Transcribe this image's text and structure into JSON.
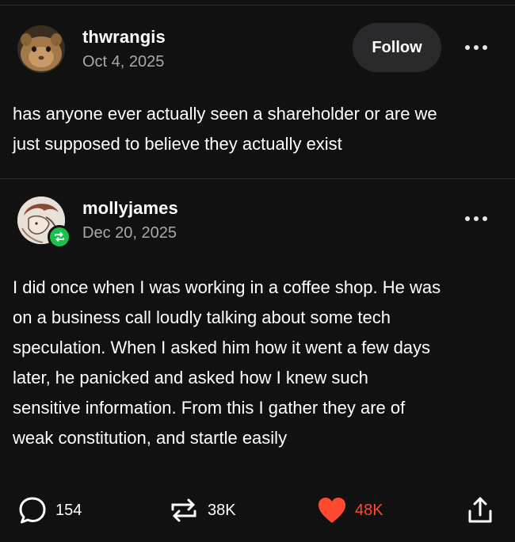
{
  "post": {
    "username": "thwrangis",
    "date": "Oct 4, 2025",
    "follow_label": "Follow",
    "text": "has anyone ever actually seen a shareholder or are we\njust supposed to believe they actually exist"
  },
  "reply": {
    "username": "mollyjames",
    "date": "Dec 20, 2025",
    "text": "I did once when I was working in a coffee shop. He was\non a business call loudly talking about some tech\nspeculation. When I asked him how it went a few days\nlater, he panicked and asked how I knew such\nsensitive information. From this I gather they are of\nweak constitution, and startle easily"
  },
  "actions": {
    "comments": "154",
    "reblogs": "38K",
    "likes": "48K"
  },
  "icons": {
    "more": "more-dots-icon",
    "comment": "comment-bubble-icon",
    "reblog": "reblog-arrows-icon",
    "like": "heart-icon",
    "share": "share-icon"
  },
  "colors": {
    "background": "#111112",
    "follow_bg": "#2a2a2c",
    "muted_text": "#a9a9ab",
    "reblog_green": "#1bbf4e",
    "like_red": "#ff4930"
  }
}
